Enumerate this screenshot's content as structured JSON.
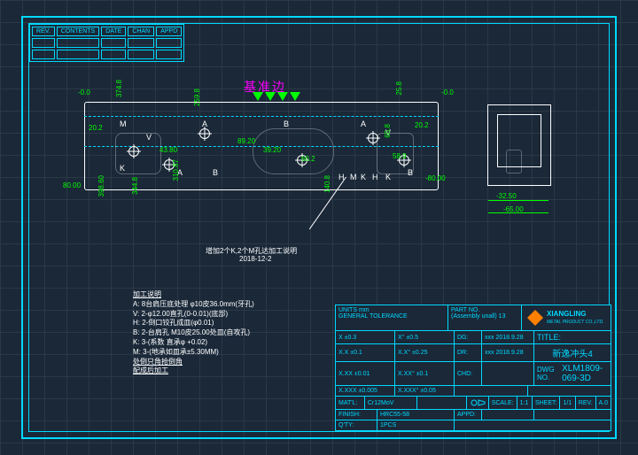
{
  "rev_table": {
    "h1": "REV.",
    "h2": "CONTENTS",
    "h3": "DATE",
    "h4": "CHAN",
    "h5": "APPD"
  },
  "datum_title": "基准边",
  "dims": {
    "d1": "374.8",
    "d2": "-0.0",
    "d3": "-0.0",
    "d4": "259.8",
    "d5": "20.2",
    "d6": "43.80",
    "d7": "89.20",
    "d8": "39.20",
    "d9": "60.2",
    "d10": "20.2",
    "d11": "25.8",
    "d12": "65.8",
    "d13": "58.9",
    "d14": "80.00",
    "d15": "-80.00",
    "d16": "398.60",
    "d17": "344.8",
    "d18": "310.87",
    "d19": "140.8",
    "d20": "-32.50",
    "d21": "-65.00"
  },
  "labels": {
    "A": "A",
    "B": "B",
    "V": "V",
    "M": "M",
    "K": "K",
    "H": "H"
  },
  "callout": {
    "l1": "增加2个K,2个M孔达加工说明",
    "l2": "2018-12-2"
  },
  "notes": {
    "title": "加工说明",
    "n1": "A: 8台肩压底处理 φ10皮36.0mm(牙孔)",
    "n2": "V: 2-φ12.00直孔(0-0.01)(底部)",
    "n3": "H: 2-倒口铰孔成皿(φ0.01)",
    "n4": "B: 2-台肩孔 M10皮25.00处皿(自攻孔)",
    "n5": "K: 3-(系数 直承φ +0.02)",
    "n6": "M: 3-(地承如皿承±5.30MM)",
    "n7": "处倒只角抢倒角",
    "n8": "配成后加工"
  },
  "tb": {
    "units": "UNITS mm",
    "gentol": "GENERAL TOLERANCE",
    "x1": "X  ±0.3",
    "x2": "X°  ±0.5",
    "x3": "X.X  ±0.1",
    "x4": "X.X° ±0.25",
    "x5": "X.XX ±0.01",
    "x6": "X.XX° ±0.1",
    "x7": "X.XXX ±0.005",
    "x8": "X.XXX° ±0.05",
    "matl": "MAT'L:",
    "matv": "Cr12MoV",
    "fin": "FINISH:",
    "finv": "HRC55-58",
    "qty": "Q'TY:",
    "qtyv": "1PCS",
    "part": "PART NO.",
    "partv": "(Assembly unall)  13",
    "dg": "DG:",
    "dgv": "xxx 2018.9.28",
    "dr": "DR:",
    "drv": "xxx 2018.9.28",
    "chd": "CHD:",
    "appd": "APPD:",
    "company": "XIANGLING",
    "company2": "METAL PRODUCT CO.,LTD.",
    "title": "TITLE:",
    "titlev": "新逸冲头4",
    "dwg": "DWG NO.",
    "dwgv": "XLM1809-069-3D",
    "scale": "SCALE:",
    "scalev": "1:1",
    "sheet": "SHEET:",
    "sheetv": "1/1",
    "rev": "REV.",
    "revv": "A.0"
  }
}
